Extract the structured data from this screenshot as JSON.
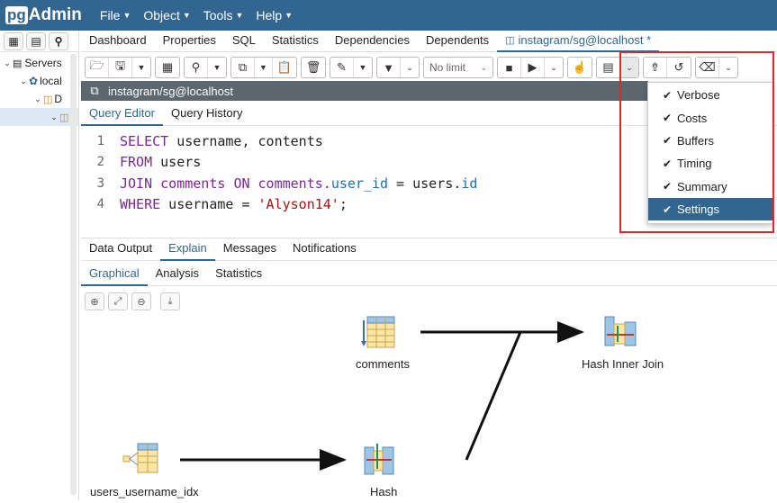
{
  "app": {
    "logo_pg": "pg",
    "logo_admin": "Admin"
  },
  "menus": [
    "File",
    "Object",
    "Tools",
    "Help"
  ],
  "sidebar": {
    "tree": [
      {
        "label": "Servers",
        "level": 0
      },
      {
        "label": "local",
        "level": 1
      },
      {
        "label": "D",
        "level": 2
      },
      {
        "label": "",
        "level": 3
      }
    ]
  },
  "main_tabs": [
    "Dashboard",
    "Properties",
    "SQL",
    "Statistics",
    "Dependencies",
    "Dependents",
    "instagram/sg@localhost *"
  ],
  "toolbar": {
    "limit_label": "No limit"
  },
  "query_header": {
    "connection": "instagram/sg@localhost"
  },
  "query_tabs": [
    "Query Editor",
    "Query History"
  ],
  "editor": {
    "lines": [
      {
        "num": "1",
        "parts": [
          {
            "t": "SELECT",
            "c": "kw"
          },
          {
            "t": " username, contents",
            "c": ""
          }
        ]
      },
      {
        "num": "2",
        "parts": [
          {
            "t": "FROM",
            "c": "kw"
          },
          {
            "t": " users",
            "c": ""
          }
        ]
      },
      {
        "num": "3",
        "parts": [
          {
            "t": "JOIN",
            "c": "kw"
          },
          {
            "t": " comments ",
            "c": "kw"
          },
          {
            "t": "ON",
            "c": "kw"
          },
          {
            "t": " comments.",
            "c": "kw"
          },
          {
            "t": "user_id",
            "c": "id"
          },
          {
            "t": " = users.",
            "c": ""
          },
          {
            "t": "id",
            "c": "id"
          }
        ]
      },
      {
        "num": "4",
        "parts": [
          {
            "t": "WHERE",
            "c": "kw"
          },
          {
            "t": " username = ",
            "c": ""
          },
          {
            "t": "'Alyson14'",
            "c": "str"
          },
          {
            "t": ";",
            "c": ""
          }
        ]
      }
    ]
  },
  "output_tabs": [
    "Data Output",
    "Explain",
    "Messages",
    "Notifications"
  ],
  "explain_tabs": [
    "Graphical",
    "Analysis",
    "Statistics"
  ],
  "plan_nodes": {
    "comments": "comments",
    "hash_join": "Hash Inner Join",
    "index": "users_username_idx",
    "hash": "Hash"
  },
  "explain_options": [
    {
      "label": "Verbose",
      "checked": true
    },
    {
      "label": "Costs",
      "checked": true
    },
    {
      "label": "Buffers",
      "checked": true
    },
    {
      "label": "Timing",
      "checked": true
    },
    {
      "label": "Summary",
      "checked": true
    },
    {
      "label": "Settings",
      "checked": true,
      "highlighted": true
    }
  ],
  "colors": {
    "brand": "#326690",
    "highlight": "#e0262f"
  }
}
